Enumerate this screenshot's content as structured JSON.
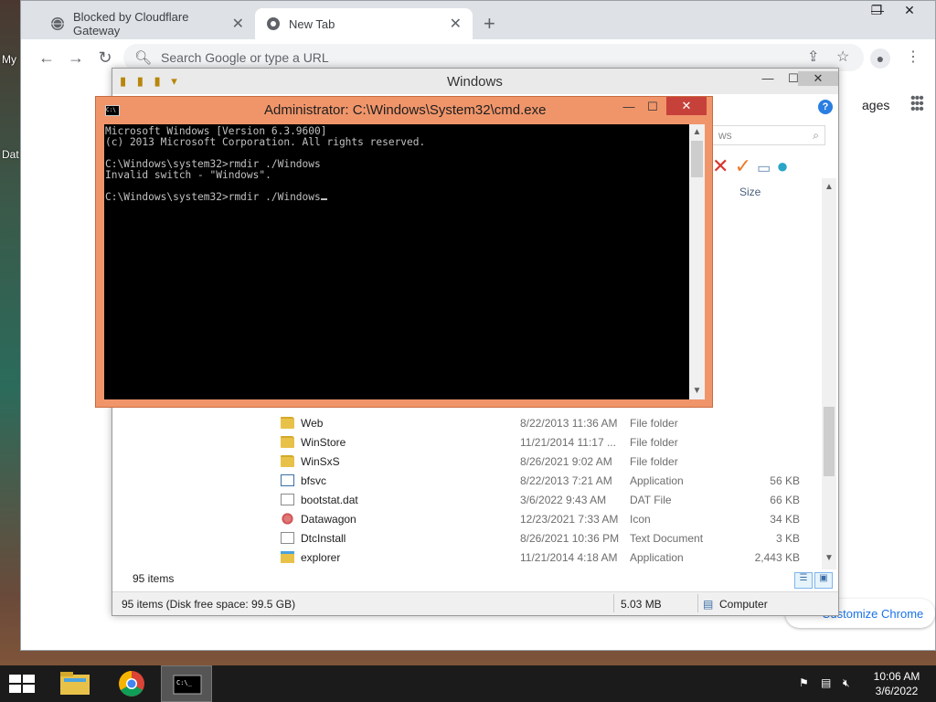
{
  "desktop": {
    "icons": [
      {
        "label": "My"
      },
      {
        "label": "Dat"
      }
    ]
  },
  "chrome": {
    "tabs": [
      {
        "title": "Blocked by Cloudflare Gateway",
        "active": false
      },
      {
        "title": "New Tab",
        "active": true
      }
    ],
    "omnibox_placeholder": "Search Google or type a URL",
    "ntp_images_label": "ages",
    "customize_label": "Customize Chrome"
  },
  "explorer": {
    "title": "Windows",
    "search_placeholder": "ws",
    "size_column": "Size",
    "files": [
      {
        "name": "Web",
        "date": "8/22/2013 11:36 AM",
        "type": "File folder",
        "size": "",
        "icon": "folder"
      },
      {
        "name": "WinStore",
        "date": "11/21/2014 11:17 ...",
        "type": "File folder",
        "size": "",
        "icon": "folder"
      },
      {
        "name": "WinSxS",
        "date": "8/26/2021 9:02 AM",
        "type": "File folder",
        "size": "",
        "icon": "folder"
      },
      {
        "name": "bfsvc",
        "date": "8/22/2013 7:21 AM",
        "type": "Application",
        "size": "56 KB",
        "icon": "app"
      },
      {
        "name": "bootstat.dat",
        "date": "3/6/2022 9:43 AM",
        "type": "DAT File",
        "size": "66 KB",
        "icon": "dat"
      },
      {
        "name": "Datawagon",
        "date": "12/23/2021 7:33 AM",
        "type": "Icon",
        "size": "34 KB",
        "icon": "gear"
      },
      {
        "name": "DtcInstall",
        "date": "8/26/2021 10:36 PM",
        "type": "Text Document",
        "size": "3 KB",
        "icon": "doc"
      },
      {
        "name": "explorer",
        "date": "11/21/2014 4:18 AM",
        "type": "Application",
        "size": "2,443 KB",
        "icon": "explorer"
      }
    ],
    "item_count": "95 items",
    "status": {
      "items_disk": "95 items (Disk free space: 99.5 GB)",
      "size": "5.03 MB",
      "location": "Computer"
    }
  },
  "cmd": {
    "title": "Administrator: C:\\Windows\\System32\\cmd.exe",
    "lines": [
      "Microsoft Windows [Version 6.3.9600]",
      "(c) 2013 Microsoft Corporation. All rights reserved.",
      "",
      "C:\\Windows\\system32>rmdir ./Windows",
      "Invalid switch - \"Windows\".",
      "",
      "C:\\Windows\\system32>rmdir ./Windows"
    ]
  },
  "taskbar": {
    "time": "10:06 AM",
    "date": "3/6/2022"
  }
}
